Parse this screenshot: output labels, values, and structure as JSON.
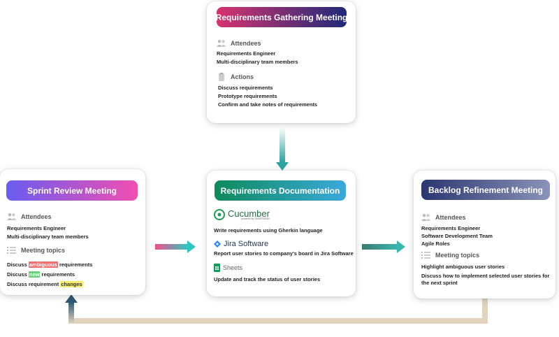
{
  "top": {
    "title": "Requirements Gathering Meeting",
    "attendees_label": "Attendees",
    "attendees": [
      "Requirements Engineer",
      "Multi-disciplinary team members"
    ],
    "actions_label": "Actions",
    "actions": [
      "Discuss requirements",
      "Prototype requirements",
      "Confirm and take notes of requirements"
    ]
  },
  "left": {
    "title": "Sprint Review Meeting",
    "attendees_label": "Attendees",
    "attendees": [
      "Requirements Engineer",
      "Multi-disciplinary team members"
    ],
    "topics_label": "Meeting topics",
    "topics": [
      {
        "pre": "Discuss ",
        "hl": "ambiguous",
        "post": " requirements"
      },
      {
        "pre": "Discuss ",
        "hl": "new",
        "post": " requirements"
      },
      {
        "pre": "Discuss requirement ",
        "hl": "changes",
        "post": ""
      }
    ]
  },
  "center": {
    "title": "Requirements Documentation",
    "tools": [
      {
        "name": "Cucumber",
        "sub": "powered by SMARTBEAR",
        "desc": "Write requirements using Gherkin language"
      },
      {
        "name": "Jira Software",
        "desc": "Report user stories to company's board in Jira Software"
      },
      {
        "name": "Sheets",
        "desc": "Update and track the status of user stories"
      }
    ]
  },
  "right": {
    "title": "Backlog Refinement Meeting",
    "attendees_label": "Attendees",
    "attendees": [
      "Requirements Engineer",
      "Software Development Team",
      "Agile Roles"
    ],
    "topics_label": "Meeting topics",
    "topics": [
      "Highlight ambiguous user stories",
      "Discuss how to implement selected user stories for the next sprint"
    ]
  },
  "colors": {
    "top_gradient": [
      "#d7336e",
      "#1e2a7a"
    ],
    "left_gradient": [
      "#6a5cf0",
      "#f04fb0"
    ],
    "center_gradient": [
      "#0f8a5c",
      "#3aa9dc"
    ],
    "right_gradient": [
      "#2a3670",
      "#8a93b8"
    ],
    "connector_teal": "#2aa5a0",
    "connector_tan": "#e2d3bd"
  }
}
